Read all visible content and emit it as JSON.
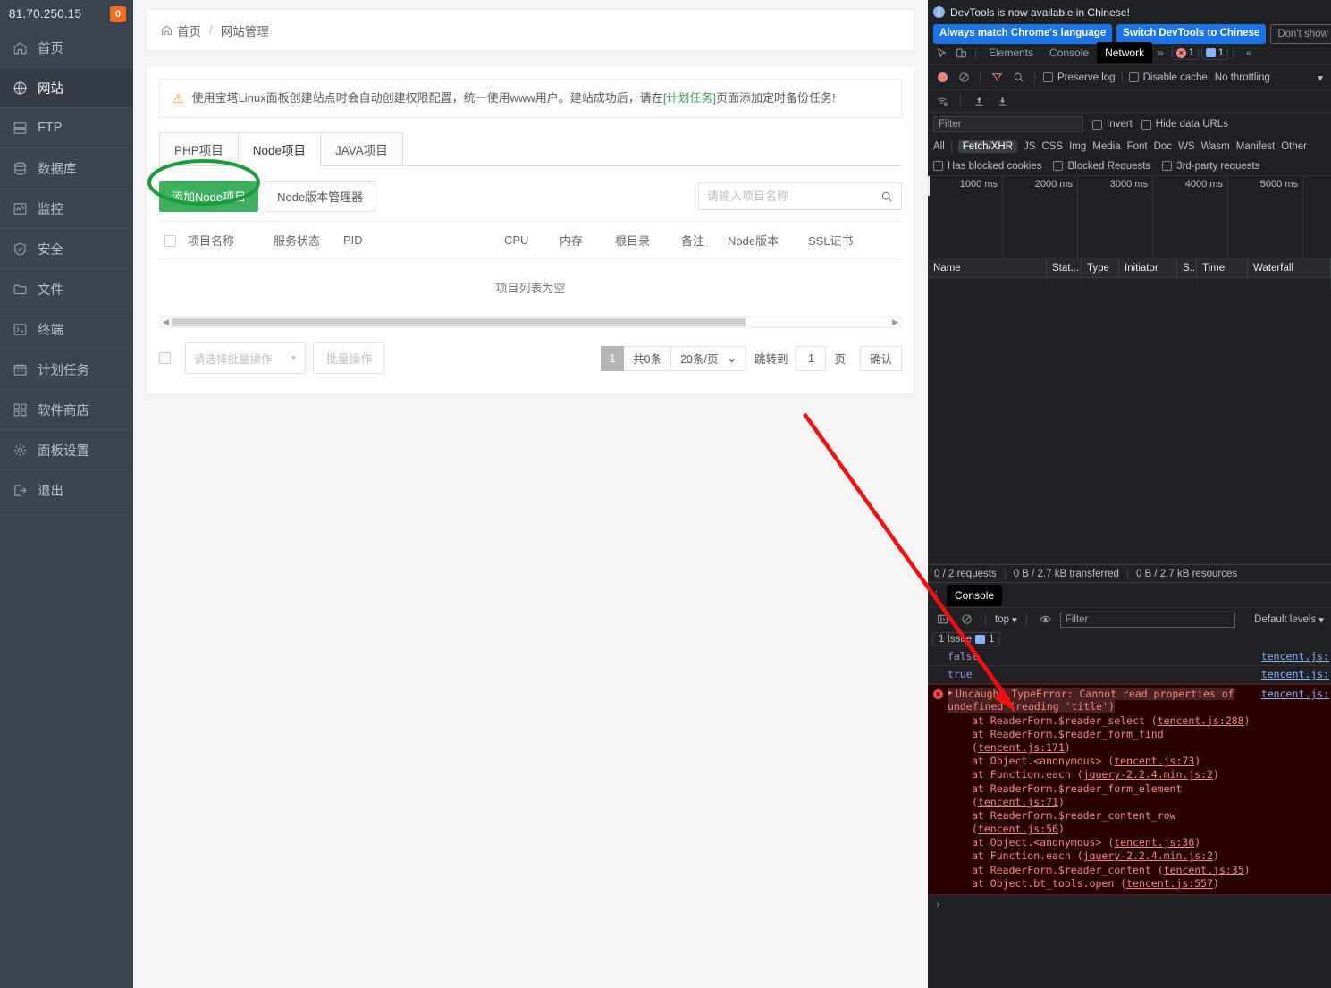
{
  "sidebar": {
    "ip": "81.70.250.15",
    "badge": "0",
    "items": [
      {
        "label": "首页",
        "icon": "home-icon"
      },
      {
        "label": "网站",
        "icon": "globe-icon"
      },
      {
        "label": "FTP",
        "icon": "ftp-icon"
      },
      {
        "label": "数据库",
        "icon": "database-icon"
      },
      {
        "label": "监控",
        "icon": "monitor-icon"
      },
      {
        "label": "安全",
        "icon": "shield-icon"
      },
      {
        "label": "文件",
        "icon": "folder-icon"
      },
      {
        "label": "终端",
        "icon": "terminal-icon"
      },
      {
        "label": "计划任务",
        "icon": "calendar-icon"
      },
      {
        "label": "软件商店",
        "icon": "grid-icon"
      },
      {
        "label": "面板设置",
        "icon": "gear-icon"
      },
      {
        "label": "退出",
        "icon": "logout-icon"
      }
    ]
  },
  "breadcrumb": {
    "home": "首页",
    "sep": "/",
    "current": "网站管理"
  },
  "warning": {
    "text_before": "使用宝塔Linux面板创建站点时会自动创建权限配置，统一使用www用户。建站成功后，请在",
    "link": "[计划任务]",
    "text_after": "页面添加定时备份任务!"
  },
  "tabs": [
    {
      "label": "PHP项目",
      "active": false
    },
    {
      "label": "Node项目",
      "active": true
    },
    {
      "label": "JAVA项目",
      "active": false
    }
  ],
  "toolbar": {
    "add_button": "添加Node项目",
    "version_manager_button": "Node版本管理器",
    "search_placeholder": "请输入项目名称",
    "search_value": ""
  },
  "table": {
    "columns": [
      "项目名称",
      "服务状态",
      "PID",
      "CPU",
      "内存",
      "根目录",
      "备注",
      "Node版本",
      "SSL证书"
    ],
    "empty_text": "项目列表为空"
  },
  "footer": {
    "batch_select": "请选择批量操作",
    "batch_button": "批量操作",
    "page_current": "1",
    "total": "共0条",
    "per_page": "20条/页",
    "jump_label": "跳转到",
    "jump_value": "1",
    "page_unit": "页",
    "confirm": "确认"
  },
  "devtools": {
    "banner": {
      "message": "DevTools is now available in Chinese!",
      "btn_always": "Always match Chrome's language",
      "btn_switch": "Switch DevTools to Chinese",
      "btn_dismiss": "Don't show again"
    },
    "tabs": [
      {
        "label": "Elements",
        "active": false
      },
      {
        "label": "Console",
        "active": false
      },
      {
        "label": "Network",
        "active": true
      }
    ],
    "more": "»",
    "error_count": "1",
    "message_count": "1",
    "network_toolbar": {
      "preserve_log": "Preserve log",
      "disable_cache": "Disable cache",
      "throttling": "No throttling"
    },
    "filter": {
      "placeholder": "Filter",
      "invert": "Invert",
      "hide_data_urls": "Hide data URLs"
    },
    "types": [
      "All",
      "Fetch/XHR",
      "JS",
      "CSS",
      "Img",
      "Media",
      "Font",
      "Doc",
      "WS",
      "Wasm",
      "Manifest",
      "Other"
    ],
    "active_type": "Fetch/XHR",
    "flags": [
      "Has blocked cookies",
      "Blocked Requests",
      "3rd-party requests"
    ],
    "timeline_ticks": [
      "1000 ms",
      "2000 ms",
      "3000 ms",
      "4000 ms",
      "5000 ms"
    ],
    "request_columns": [
      "Name",
      "Stat...",
      "Type",
      "Initiator",
      "S..",
      "Time",
      "Waterfall"
    ],
    "status": [
      "0 / 2 requests",
      "0 B / 2.7 kB transferred",
      "0 B / 2.7 kB resources"
    ],
    "drawer": {
      "tab": "Console",
      "context": "top",
      "filter_placeholder": "Filter",
      "levels": "Default levels",
      "issues": "1 Issue",
      "issue_count": "1",
      "prompt": "›"
    },
    "console_log": [
      {
        "type": "value",
        "text": "false",
        "source": "tencent.js:"
      },
      {
        "type": "value",
        "text": "true",
        "source": "tencent.js:"
      }
    ],
    "console_error": {
      "title": "Uncaught TypeError: Cannot read properties of undefined (reading 'title')",
      "source": "tencent.js:",
      "stack": [
        {
          "fn": "at ReaderForm.$reader_select (",
          "loc": "tencent.js:288",
          "tail": ")"
        },
        {
          "fn": "at ReaderForm.$reader_form_find (",
          "loc": "tencent.js:171",
          "tail": ")"
        },
        {
          "fn": "at Object.<anonymous> (",
          "loc": "tencent.js:73",
          "tail": ")"
        },
        {
          "fn": "at Function.each (",
          "loc": "jquery-2.2.4.min.js:2",
          "tail": ")"
        },
        {
          "fn": "at ReaderForm.$reader_form_element (",
          "loc": "tencent.js:71",
          "tail": ")"
        },
        {
          "fn": "at ReaderForm.$reader_content_row (",
          "loc": "tencent.js:56",
          "tail": ")"
        },
        {
          "fn": "at Object.<anonymous> (",
          "loc": "tencent.js:36",
          "tail": ")"
        },
        {
          "fn": "at Function.each (",
          "loc": "jquery-2.2.4.min.js:2",
          "tail": ")"
        },
        {
          "fn": "at ReaderForm.$reader_content (",
          "loc": "tencent.js:35",
          "tail": ")"
        },
        {
          "fn": "at Object.bt_tools.open (",
          "loc": "tencent.js:557",
          "tail": ")"
        }
      ]
    }
  },
  "annotations": {
    "highlight_color": "#1a9c3c",
    "arrow_color": "#fb0d0d"
  }
}
